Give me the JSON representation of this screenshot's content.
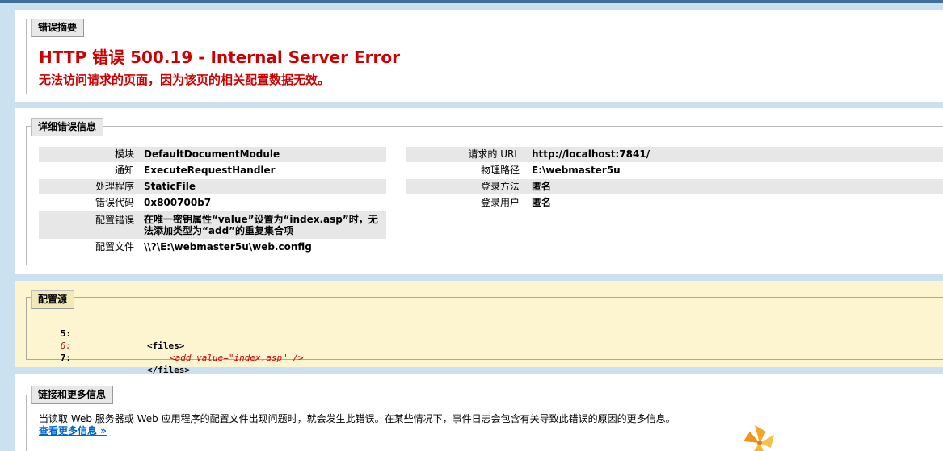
{
  "summary": {
    "legend": "错误摘要",
    "title": "HTTP 错误 500.19 - Internal Server Error",
    "subtitle": "无法访问请求的页面，因为该页的相关配置数据无效。"
  },
  "details": {
    "legend": "详细错误信息",
    "left": [
      {
        "label": "模块",
        "value": "DefaultDocumentModule"
      },
      {
        "label": "通知",
        "value": "ExecuteRequestHandler"
      },
      {
        "label": "处理程序",
        "value": "StaticFile"
      },
      {
        "label": "错误代码",
        "value": "0x800700b7"
      },
      {
        "label": "配置错误",
        "value": "在唯一密钥属性“value”设置为“index.asp”时，无法添加类型为“add”的重复集合项"
      },
      {
        "label": "配置文件",
        "value": "\\\\?\\E:\\webmaster5u\\web.config"
      }
    ],
    "right": [
      {
        "label": "请求的 URL",
        "value": "http://localhost:7841/"
      },
      {
        "label": "物理路径",
        "value": "E:\\webmaster5u"
      },
      {
        "label": "登录方法",
        "value": "匿名"
      },
      {
        "label": "登录用户",
        "value": "匿名"
      }
    ]
  },
  "config_source": {
    "legend": "配置源",
    "lines": [
      {
        "num": "5:",
        "text": "<files>"
      },
      {
        "num": "6:",
        "text": "<add value=\"index.asp\" />"
      },
      {
        "num": "7:",
        "text": "</files>"
      }
    ]
  },
  "more_info": {
    "legend": "链接和更多信息",
    "text": "当读取 Web 服务器或 Web 应用程序的配置文件出现问题时，就会发生此错误。在某些情况下，事件日志会包含有关导致此错误的原因的更多信息。",
    "link": "查看更多信息 »"
  },
  "colors": {
    "error_red": "#cc0000",
    "link_blue": "#0066cc",
    "page_bg": "#cbe1ef",
    "config_bg": "#fcf5cf"
  }
}
